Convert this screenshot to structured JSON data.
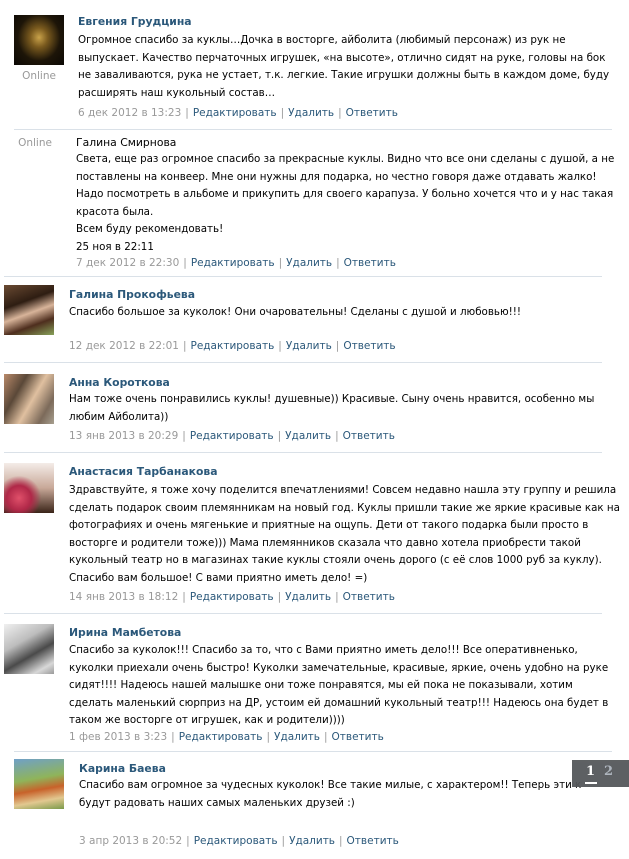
{
  "online_label": "Online",
  "actions": {
    "edit": "Редактировать",
    "delete": "Удалить",
    "reply": "Ответить"
  },
  "posts": [
    {
      "author": "Евгения Грудцина",
      "text": "Огромное спасибо за куклы…Дочка в восторге, айболита (любимый персонаж) из рук не\nвыпускает. Качество перчаточных игрушек, «на высоте», отлично сидят на руке, головы на бок\nне заваливаются, рука не устает, т.к. легкие. Такие игрушки должны быть в каждом доме, буду\nрасширять наш кукольный состав…",
      "date": "6 дек 2012 в 13:23"
    },
    {
      "author": "Галина Смирнова",
      "text": "Света, еще раз огромное спасибо за прекрасные куклы. Видно что все они сделаны с душой, а не\nпоставлены на конвеер. Мне они нужны для подарка, но честно говоря даже отдавать жалко!\nНадо посмотреть в альбоме и прикупить для своего карапуза. У больно хочется что и у нас такая\nкрасота была.\nВсем буду рекомендовать!\n25 ноя в 22:11",
      "date": "7 дек 2012 в 22:30"
    },
    {
      "author": "Галина Прокофьева",
      "text": "Спасибо большое за куколок! Они очаровательны! Сделаны с душой и любовью!!!",
      "date": "12 дек 2012 в 22:01"
    },
    {
      "author": "Анна Короткова",
      "text": "Нам тоже очень понравились куклы! душевные)) Красивые. Сыну очень нравится, особенно мы\nлюбим Айболита))",
      "date": "13 янв 2013 в 20:29"
    },
    {
      "author": "Анастасия Тарбанакова",
      "text": "Здравствуйте, я тоже хочу поделится впечатлениями! Совсем недавно нашла эту группу и решила\nсделать подарок своим племянникам на новый год. Куклы пришли такие же яркие красивые как на\nфотографиях и очень мягенькие и приятные на ощупь. Дети от такого подарка были просто в\nвосторге и родители тоже))) Мама племянников сказала что давно хотела приобрести такой\nкукольный театр но в магазинах такие куклы стояли очень дорого (с её слов 1000 руб за куклу).\nСпасибо вам большое! С вами приятно иметь дело! =)",
      "date": "14 янв 2013 в 18:12"
    },
    {
      "author": "Ирина Мамбетова",
      "text": "Спасибо за куколок!!! Спасибо за то, что с Вами приятно иметь дело!!! Все оперативненько,\nкуколки приехали очень быстро! Куколки замечательные, красивые, яркие, очень удобно на руке\nсидят!!!! Надеюсь нашей малышке они тоже понравятся, мы ей пока не показывали, хотим\nсделать маленький сюрприз на ДР, устоим ей домашний кукольный театр!!! Надеюсь она будет в\nтаком же восторге от игрушек, как и родители))))",
      "date": "1 фев 2013 в 3:23"
    },
    {
      "author": "Карина Баева",
      "text": "Спасибо вам огромное за чудесных куколок! Все такие милые, с характером!! Теперь эти куколки\nбудут радовать наших самых маленьких друзей :)",
      "date": "3 апр 2013 в 20:52"
    }
  ],
  "pager": {
    "current": "1",
    "next": "2"
  }
}
